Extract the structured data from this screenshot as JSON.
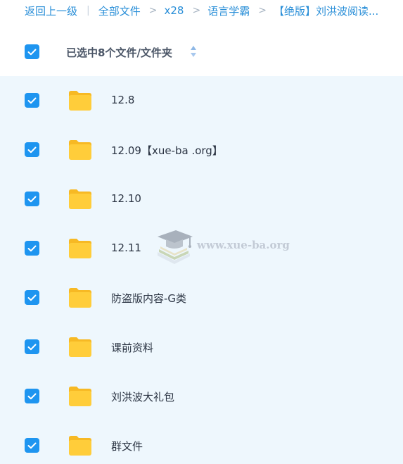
{
  "breadcrumb": {
    "back": "返回上一级",
    "items": [
      "全部文件",
      "x28",
      "语言学霸"
    ],
    "current": "【绝版】刘洪波阅读..."
  },
  "header": {
    "selection_label": "已选中8个文件/文件夹"
  },
  "files": [
    {
      "name": "12.8",
      "checked": true,
      "icon": "folder-icon"
    },
    {
      "name": "12.09【xue-ba .org】",
      "checked": true,
      "icon": "folder-icon"
    },
    {
      "name": "12.10",
      "checked": true,
      "icon": "folder-icon"
    },
    {
      "name": "12.11",
      "checked": true,
      "icon": "folder-icon"
    },
    {
      "name": "防盗版内容-G类",
      "checked": true,
      "icon": "folder-icon"
    },
    {
      "name": "课前资料",
      "checked": true,
      "icon": "folder-icon"
    },
    {
      "name": "刘洪波大礼包",
      "checked": true,
      "icon": "folder-icon"
    },
    {
      "name": "群文件",
      "checked": true,
      "icon": "folder-icon"
    }
  ],
  "watermark": {
    "text": "www.xue-ba.org"
  },
  "colors": {
    "accent": "#1e95f0",
    "link": "#2a8fd8",
    "folder": "#ffc933",
    "list_bg": "#eef7fd"
  }
}
